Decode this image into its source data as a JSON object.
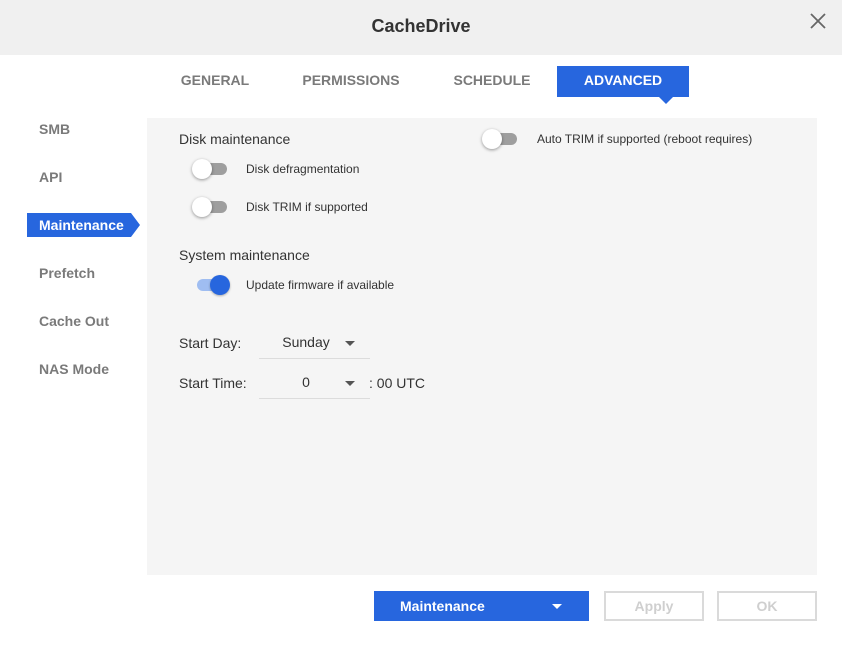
{
  "window": {
    "title": "CacheDrive",
    "close_icon": "close-icon"
  },
  "tabs": [
    {
      "label": "GENERAL",
      "active": false
    },
    {
      "label": "PERMISSIONS",
      "active": false
    },
    {
      "label": "SCHEDULE",
      "active": false
    },
    {
      "label": "ADVANCED",
      "active": true
    }
  ],
  "sidebar": {
    "items": [
      {
        "label": "SMB",
        "active": false
      },
      {
        "label": "API",
        "active": false
      },
      {
        "label": "Maintenance",
        "active": true
      },
      {
        "label": "Prefetch",
        "active": false
      },
      {
        "label": "Cache Out",
        "active": false
      },
      {
        "label": "NAS Mode",
        "active": false
      }
    ]
  },
  "main": {
    "disk_section_title": "Disk maintenance",
    "disk_defrag": {
      "label": "Disk defragmentation",
      "on": false
    },
    "disk_trim": {
      "label": "Disk TRIM if supported",
      "on": false
    },
    "auto_trim": {
      "label": "Auto TRIM if supported (reboot requires)",
      "on": false
    },
    "system_section_title": "System maintenance",
    "update_firmware": {
      "label": "Update firmware if available",
      "on": true
    },
    "start_day": {
      "label": "Start Day:",
      "value": "Sunday"
    },
    "start_time": {
      "label": "Start Time:",
      "value": "0",
      "suffix": ": 00 UTC"
    }
  },
  "footer": {
    "mode_button": "Maintenance",
    "apply_button": "Apply",
    "ok_button": "OK"
  },
  "colors": {
    "accent": "#2766de",
    "header_bg": "#f0f0f0",
    "panel_bg": "#f5f5f5",
    "disabled_text": "#cfcfcf"
  }
}
